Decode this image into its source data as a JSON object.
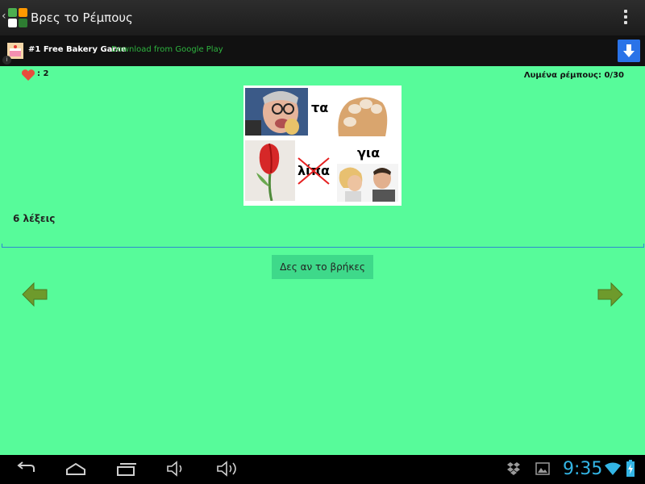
{
  "app": {
    "title": "Βρες το Ρέμπους",
    "icons": [
      "back-caret-icon",
      "app-logo-icon",
      "overflow-menu-icon"
    ]
  },
  "ad": {
    "title": "#1 Free Bakery Game",
    "subtitle": "Download from Google Play",
    "info": "i"
  },
  "stats": {
    "lives": ": 2",
    "solved": "Λυμένα ρέμπους: 0/30"
  },
  "puzzle": {
    "words": [
      "τα",
      "λίπα",
      "για"
    ],
    "struck_word": "λίπα",
    "images": [
      "man-eating-image",
      "hand-nails-image",
      "tulip-image",
      "couple-arguing-image"
    ]
  },
  "hint": {
    "word_count": "6 λέξεις"
  },
  "answer": {
    "value": ""
  },
  "actions": {
    "check": "Δες αν το βρήκες"
  },
  "navigation": {
    "prev": "arrow-left-icon",
    "next": "arrow-right-icon"
  },
  "status": {
    "time": "9:35"
  },
  "colors": {
    "background": "#57fb9a",
    "button": "#3ed98a",
    "accent": "#33b5e5",
    "ad_download": "#2a73e8"
  }
}
